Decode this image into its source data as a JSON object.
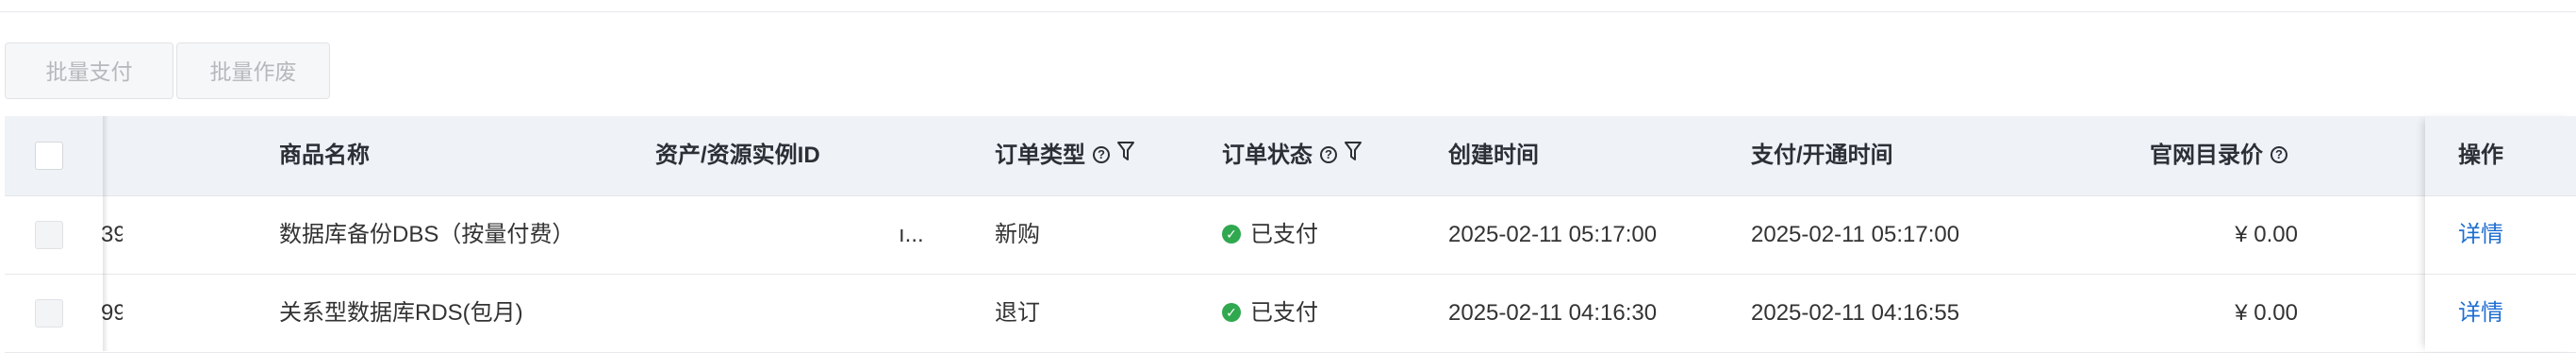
{
  "toolbar": {
    "batch_pay_label": "批量支付",
    "batch_void_label": "批量作废"
  },
  "table": {
    "columns": {
      "product_name": "商品名称",
      "resource_id": "资产/资源实例ID",
      "order_type": "订单类型",
      "order_status": "订单状态",
      "created_time": "创建时间",
      "paid_time": "支付/开通时间",
      "list_price": "官网目录价",
      "actions": "操作"
    },
    "rows": [
      {
        "order_id_partial": "39",
        "product_name": "数据库备份DBS（按量付费）",
        "resource_id_partial": "ı...",
        "order_type": "新购",
        "order_status": "已支付",
        "created_time": "2025-02-11 05:17:00",
        "paid_time": "2025-02-11 05:17:00",
        "list_price": "¥ 0.00",
        "action": "详情"
      },
      {
        "order_id_partial": "99",
        "product_name": "关系型数据库RDS(包月)",
        "resource_id_partial": "",
        "order_type": "退订",
        "order_status": "已支付",
        "created_time": "2025-02-11 04:16:30",
        "paid_time": "2025-02-11 04:16:55",
        "list_price": "¥ 0.00",
        "action": "详情"
      }
    ]
  },
  "colors": {
    "header_bg": "#eff2f6",
    "link": "#1f6fd1",
    "status_paid": "#2fa84f",
    "disabled_text": "#b6b8bc"
  },
  "icons": {
    "help": "help-circle-icon",
    "filter": "filter-icon",
    "status": "check-circle-icon"
  }
}
